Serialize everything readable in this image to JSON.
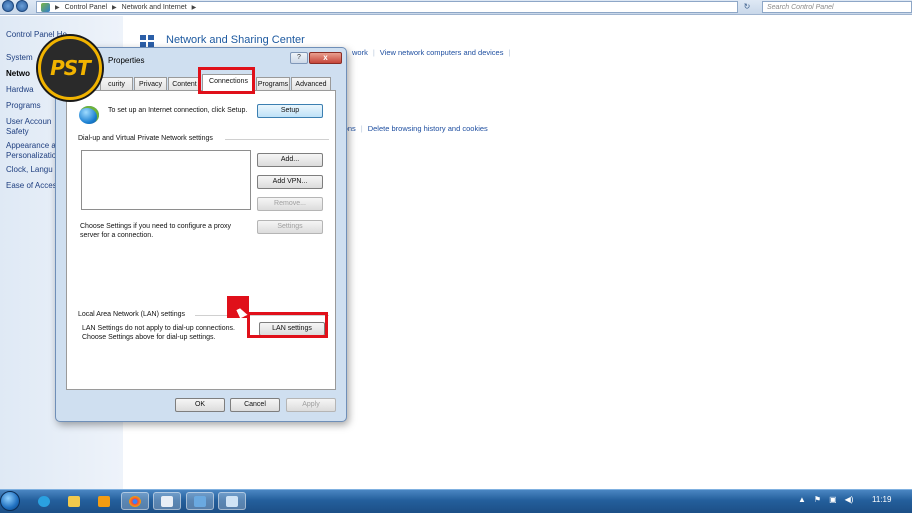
{
  "address_bar": {
    "breadcrumbs": [
      "Control Panel",
      "Network and Internet"
    ],
    "search_placeholder": "Search Control Panel"
  },
  "left_nav": {
    "items": [
      "Control Panel Home",
      "System and Security",
      "Network and Internet",
      "Hardware and Sound",
      "Programs",
      "User Accounts and Family Safety",
      "Appearance and Personalization",
      "Clock, Language, and Region",
      "Ease of Access"
    ],
    "visible_text": [
      "Control Panel Ho",
      "System",
      "Netwo",
      "Hardwa",
      "Programs",
      "User Accoun",
      "Safety",
      "Appearance a",
      "Personalizatio",
      "Clock, Langu",
      "Ease of Acces"
    ]
  },
  "main": {
    "title": "Network and Sharing Center",
    "row1_links": [
      "work",
      "View network computers and devices"
    ],
    "row2_links": [
      "ions",
      "Delete browsing history and cookies"
    ]
  },
  "logo": {
    "text": "PST"
  },
  "dialog": {
    "title": "Properties",
    "help_button": "?",
    "close_button": "x",
    "tabs": [
      "curity",
      "Privacy",
      "Content",
      "Connections",
      "Programs",
      "Advanced"
    ],
    "active_tab": "Connections",
    "setup_text": "To set up an Internet connection, click Setup.",
    "setup_button": "Setup",
    "dialup_group_label": "Dial-up and Virtual Private Network settings",
    "add_button": "Add...",
    "add_vpn_button": "Add VPN...",
    "remove_button": "Remove...",
    "proxy_text": "Choose Settings if you need to configure a proxy server for a connection.",
    "settings_button": "Settings",
    "lan_group_label": "Local Area Network (LAN) settings",
    "lan_text_line1": "LAN Settings do not apply to dial-up connections.",
    "lan_text_line2": "Choose Settings above for dial-up settings.",
    "lan_settings_button": "LAN settings",
    "ok_button": "OK",
    "cancel_button": "Cancel",
    "apply_button": "Apply"
  },
  "taskbar": {
    "clock": "11:19",
    "tray_icons": [
      "show-hidden-icons",
      "action-center-flag",
      "network-icon",
      "volume-icon"
    ]
  },
  "colors": {
    "highlight": "#e0101a",
    "title_blue": "#1e5aa0",
    "taskbar": "#245f9c"
  }
}
